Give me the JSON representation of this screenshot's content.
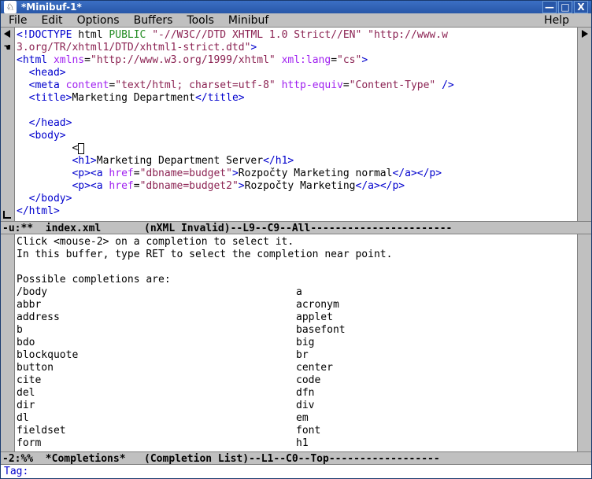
{
  "titlebar": {
    "icon_glyph": "♘",
    "title": "*Minibuf-1*",
    "min": "—",
    "max": "□",
    "close": "X"
  },
  "menubar": {
    "items": [
      "File",
      "Edit",
      "Options",
      "Buffers",
      "Tools",
      "Minibuf"
    ],
    "help": "Help"
  },
  "buffer1": {
    "l1a": "<!DOCTYPE",
    "l1b": " html ",
    "l1c": "PUBLIC",
    "l1d": " \"-//W3C//DTD XHTML 1.0 Strict//EN\"",
    "l1e": " \"http://www.w",
    "l2a": "3.org/TR/xhtml1/DTD/xhtml1-strict.dtd\"",
    "l2b": ">",
    "l3a": "<html",
    "l3b": " xmlns",
    "l3c": "=",
    "l3d": "\"http://www.w3.org/1999/xhtml\"",
    "l3e": " xml:lang",
    "l3f": "=",
    "l3g": "\"cs\"",
    "l3h": ">",
    "l4a": "  ",
    "l4b": "<head>",
    "l5a": "  ",
    "l5b": "<meta",
    "l5c": " content",
    "l5d": "=",
    "l5e": "\"text/html; charset=utf-8\"",
    "l5f": " http-equiv",
    "l5g": "=",
    "l5h": "\"Content-Type\"",
    "l5i": " />",
    "l6a": "  ",
    "l6b": "<title>",
    "l6c": "Marketing Department",
    "l6d": "</title>",
    "blank": "",
    "l8a": "  ",
    "l8b": "</head>",
    "l9a": "  ",
    "l9b": "<body>",
    "l10a": "         <",
    "l11a": "         ",
    "l11b": "<h1>",
    "l11c": "Marketing Department Server",
    "l11d": "</h1>",
    "l12a": "         ",
    "l12b": "<p><a",
    "l12c": " href",
    "l12d": "=",
    "l12e": "\"dbname=budget\"",
    "l12f": ">",
    "l12g": "Rozpočty Marketing normal",
    "l12h": "</a></p>",
    "l13a": "         ",
    "l13b": "<p><a",
    "l13c": " href",
    "l13d": "=",
    "l13e": "\"dbname=budget2\"",
    "l13f": ">",
    "l13g": "Rozpočty Marketing",
    "l13h": "</a></p>",
    "l14a": "  ",
    "l14b": "</body>",
    "l15a": "</html>"
  },
  "modeline1": "-u:**  index.xml       (nXML Invalid)--L9--C9--All-----------------------",
  "buffer2": {
    "intro1": "Click <mouse-2> on a completion to select it.",
    "intro2": "In this buffer, type RET to select the completion near point.",
    "heading": "Possible completions are:",
    "items": [
      [
        "/body",
        "a"
      ],
      [
        "abbr",
        "acronym"
      ],
      [
        "address",
        "applet"
      ],
      [
        "b",
        "basefont"
      ],
      [
        "bdo",
        "big"
      ],
      [
        "blockquote",
        "br"
      ],
      [
        "button",
        "center"
      ],
      [
        "cite",
        "code"
      ],
      [
        "del",
        "dfn"
      ],
      [
        "dir",
        "div"
      ],
      [
        "dl",
        "em"
      ],
      [
        "fieldset",
        "font"
      ],
      [
        "form",
        "h1"
      ]
    ]
  },
  "modeline2": "-2:%%  *Completions*   (Completion List)--L1--C0--Top------------------",
  "minibuf": {
    "prompt": "Tag: "
  }
}
